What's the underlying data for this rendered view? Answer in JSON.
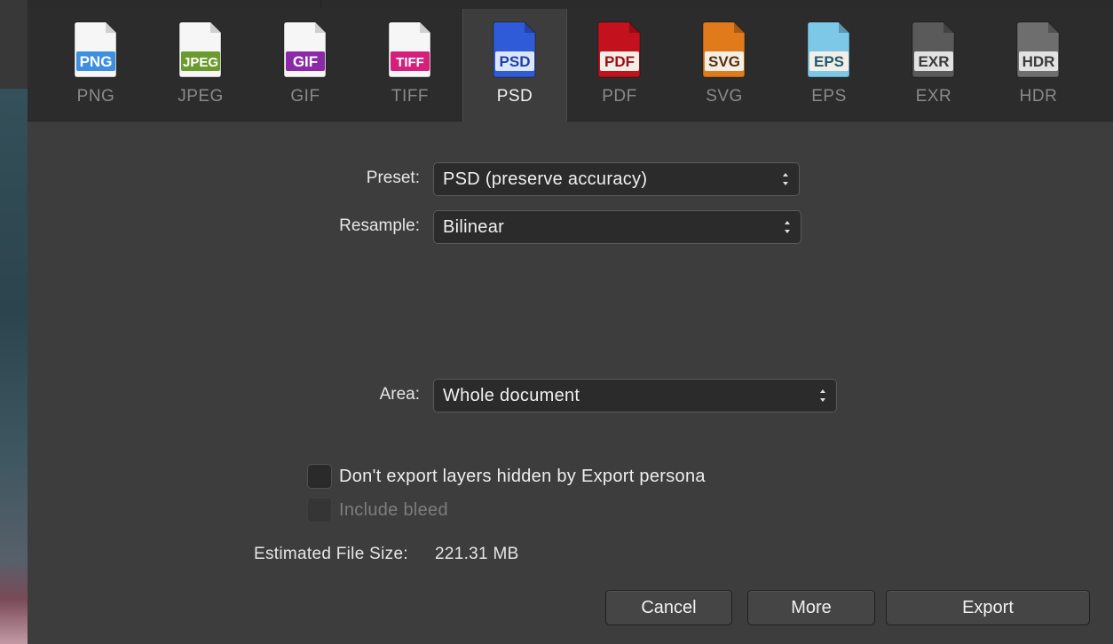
{
  "formats": [
    {
      "id": "png",
      "label": "PNG",
      "badge": "PNG",
      "color": "#3d8fe0",
      "icon": "png-file-icon",
      "selected": false
    },
    {
      "id": "jpeg",
      "label": "JPEG",
      "badge": "JPEG",
      "color": "#6b9a2e",
      "icon": "jpeg-file-icon",
      "selected": false
    },
    {
      "id": "gif",
      "label": "GIF",
      "badge": "GIF",
      "color": "#8a2aa6",
      "icon": "gif-file-icon",
      "selected": false
    },
    {
      "id": "tiff",
      "label": "TIFF",
      "badge": "TIFF",
      "color": "#d61f7a",
      "icon": "tiff-file-icon",
      "selected": false
    },
    {
      "id": "psd",
      "label": "PSD",
      "badge": "PSD",
      "color": "#2f5bd8",
      "icon": "psd-file-icon",
      "selected": true
    },
    {
      "id": "pdf",
      "label": "PDF",
      "badge": "PDF",
      "color": "#c3121e",
      "icon": "pdf-file-icon",
      "selected": false
    },
    {
      "id": "svg",
      "label": "SVG",
      "badge": "SVG",
      "color": "#e07a1a",
      "icon": "svg-file-icon",
      "selected": false
    },
    {
      "id": "eps",
      "label": "EPS",
      "badge": "EPS",
      "color": "#5ab4d6",
      "icon": "eps-file-icon",
      "selected": false
    },
    {
      "id": "exr",
      "label": "EXR",
      "badge": "EXR",
      "color": "#5a5a5a",
      "icon": "exr-file-icon",
      "selected": false
    },
    {
      "id": "hdr",
      "label": "HDR",
      "badge": "HDR",
      "color": "#6a6a6a",
      "icon": "hdr-file-icon",
      "selected": false
    }
  ],
  "form": {
    "preset_label": "Preset:",
    "preset_value": "PSD (preserve accuracy)",
    "resample_label": "Resample:",
    "resample_value": "Bilinear",
    "area_label": "Area:",
    "area_value": "Whole document"
  },
  "options": {
    "hidden_layers_label": "Don't export layers hidden by Export persona",
    "hidden_layers_checked": false,
    "include_bleed_label": "Include bleed",
    "include_bleed_checked": false,
    "include_bleed_enabled": false
  },
  "file_size": {
    "label": "Estimated File Size:",
    "value": "221.31 MB"
  },
  "buttons": {
    "cancel": "Cancel",
    "more": "More",
    "export": "Export"
  }
}
